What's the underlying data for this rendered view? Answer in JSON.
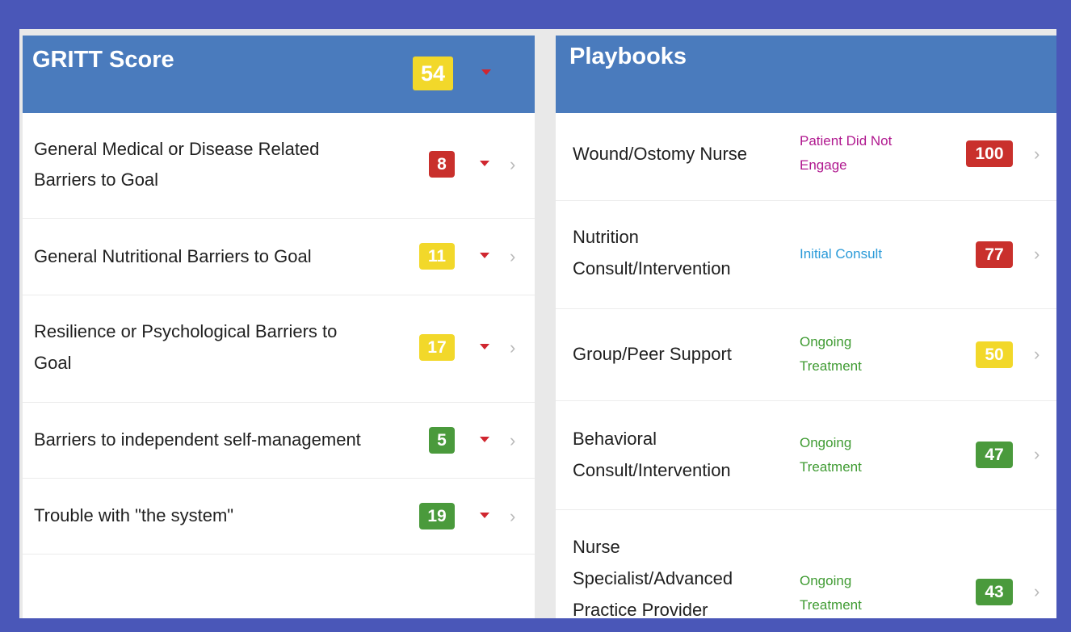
{
  "colors": {
    "frame": "#4a57b8",
    "header": "#4a7bbd",
    "red": "#c9302c",
    "yellow": "#f2d82a",
    "green": "#4a9a3c",
    "status_magenta": "#b0198f",
    "status_blue": "#2a9ad8",
    "status_green": "#3f9b32",
    "caret": "#d0262f"
  },
  "gritt": {
    "title": "GRITT Score",
    "score": "54",
    "items": [
      {
        "label_line1": "General Medical or Disease Related",
        "label_line2": "Barriers to Goal",
        "score": "8",
        "color": "red"
      },
      {
        "label_line1": "General Nutritional Barriers to Goal",
        "label_line2": "",
        "score": "11",
        "color": "yellow"
      },
      {
        "label_line1": "Resilience or Psychological Barriers to",
        "label_line2": "Goal",
        "score": "17",
        "color": "yellow"
      },
      {
        "label_line1": "Barriers to independent self-management",
        "label_line2": "",
        "score": "5",
        "color": "green"
      },
      {
        "label_line1": "Trouble with \"the system\"",
        "label_line2": "",
        "score": "19",
        "color": "green"
      }
    ]
  },
  "playbooks": {
    "title": "Playbooks",
    "items": [
      {
        "label_line1": "Wound/Ostomy Nurse",
        "label_line2": "",
        "label_line3": "",
        "status_line1": "Patient Did Not",
        "status_line2": "Engage",
        "status_color": "status_magenta",
        "score": "100",
        "color": "red"
      },
      {
        "label_line1": "Nutrition",
        "label_line2": "Consult/Intervention",
        "label_line3": "",
        "status_line1": "Initial Consult",
        "status_line2": "",
        "status_color": "status_blue",
        "score": "77",
        "color": "red"
      },
      {
        "label_line1": "Group/Peer Support",
        "label_line2": "",
        "label_line3": "",
        "status_line1": "Ongoing",
        "status_line2": "Treatment",
        "status_color": "status_green",
        "score": "50",
        "color": "yellow"
      },
      {
        "label_line1": "Behavioral",
        "label_line2": "Consult/Intervention",
        "label_line3": "",
        "status_line1": "Ongoing",
        "status_line2": "Treatment",
        "status_color": "status_green",
        "score": "47",
        "color": "green"
      },
      {
        "label_line1": "Nurse",
        "label_line2": "Specialist/Advanced",
        "label_line3": "Practice Provider",
        "status_line1": "Ongoing",
        "status_line2": "Treatment",
        "status_color": "status_green",
        "score": "43",
        "color": "green"
      }
    ]
  },
  "icons": {
    "expand": "caret-down-icon",
    "navigate": "chevron-right-icon",
    "chevron_glyph": "›"
  }
}
